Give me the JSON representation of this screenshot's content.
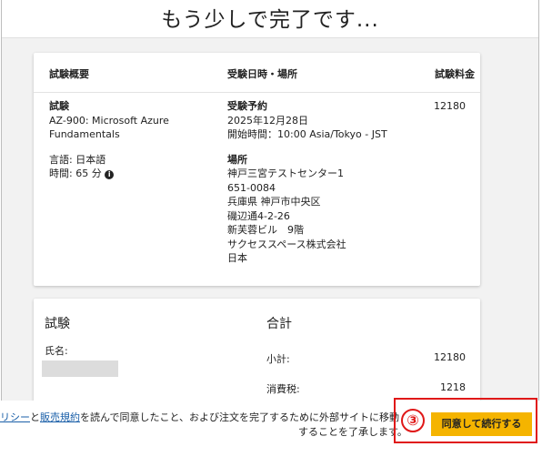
{
  "page_title": "もう少しで完了です...",
  "summary": {
    "headers": {
      "overview": "試験概要",
      "datetime_place": "受験日時・場所",
      "fee": "試験料金"
    },
    "exam_label": "試験",
    "exam_name_line1": "AZ-900: Microsoft Azure",
    "exam_name_line2": "Fundamentals",
    "language": "言語: 日本語",
    "duration": "時間: 65 分",
    "appointment_label": "受験予約",
    "date": "2025年12月28日",
    "start_time": "開始時間：10:00 Asia/Tokyo - JST",
    "place_label": "場所",
    "address_lines": [
      "神戸三宮テストセンター1",
      "651-0084",
      "兵庫県 神戸市中央区",
      "磯辺通4-2-26",
      "新芙蓉ビル　9階",
      "サクセススペース株式会社",
      "日本"
    ],
    "fee": "12180"
  },
  "details": {
    "exam_section_title": "試験",
    "name_label": "氏名:",
    "total_section_title": "合計",
    "subtotal_label": "小計:",
    "subtotal_value": "12180",
    "tax_label": "消費税:",
    "tax_value": "1218"
  },
  "footer": {
    "policy_link": "リシー",
    "text_and": "と",
    "terms_link": "販売規約",
    "text_line1_rest": "を読んで同意したこと、および注文を完了するために外部サイトに移動",
    "text_line2": "することを了承します。",
    "step_number": "③",
    "agree_button": "同意して続行する"
  },
  "colors": {
    "accent_button": "#f5b400",
    "highlight_red": "#e01818",
    "link": "#1a5fa8"
  }
}
